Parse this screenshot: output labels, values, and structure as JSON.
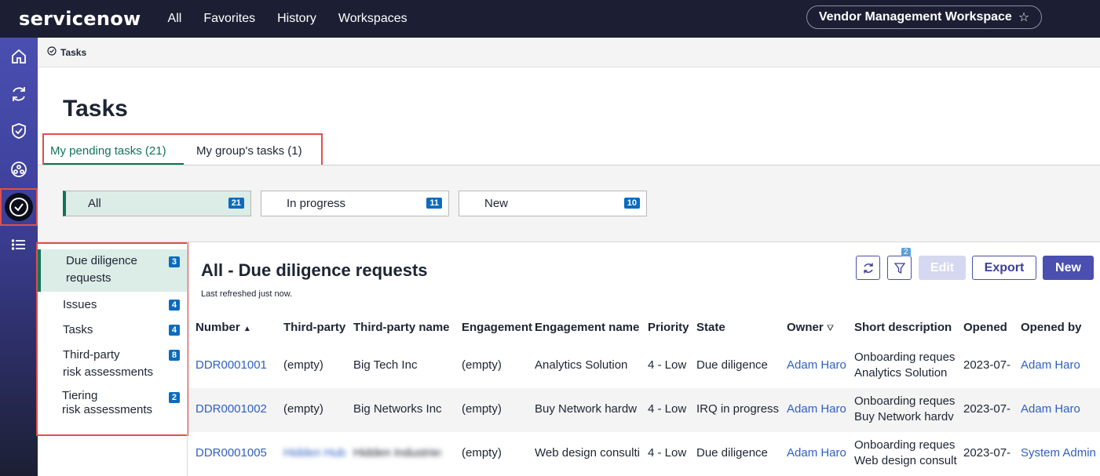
{
  "topbar": {
    "logo": "servicenow",
    "nav": [
      "All",
      "Favorites",
      "History",
      "Workspaces"
    ],
    "workspace": "Vendor Management Workspace"
  },
  "rail": {
    "icons": [
      "home-icon",
      "refresh-icon",
      "shield-check-icon",
      "network-icon",
      "check-circle-icon",
      "list-icon"
    ]
  },
  "breadcrumb": "Tasks",
  "page_title": "Tasks",
  "tabs": [
    {
      "label": "My pending tasks (21)"
    },
    {
      "label": "My group's tasks (1)"
    }
  ],
  "chips": [
    {
      "label": "All",
      "count": "21"
    },
    {
      "label": "In progress",
      "count": "11"
    },
    {
      "label": "New",
      "count": "10"
    }
  ],
  "categories": [
    {
      "line1": "Due diligence",
      "line2": "requests",
      "count": "3"
    },
    {
      "line1": "Issues",
      "line2": "",
      "count": "4"
    },
    {
      "line1": "Tasks",
      "line2": "",
      "count": "4"
    },
    {
      "line1": "Third-party",
      "line2": "risk assessments",
      "count": "8"
    },
    {
      "line1": "Tiering",
      "line2": "risk assessments",
      "count": "2"
    }
  ],
  "list": {
    "title": "All - Due diligence requests",
    "refreshed": "Last refreshed just now.",
    "filter_count": "2",
    "edit_label": "Edit",
    "export_label": "Export",
    "new_label": "New"
  },
  "columns": [
    "Number",
    "Third-party",
    "Third-party name",
    "Engagement",
    "Engagement name",
    "Priority",
    "State",
    "Owner",
    "Short description",
    "Opened",
    "Opened by"
  ],
  "rows": [
    {
      "number": "DDR0001001",
      "third_party": "(empty)",
      "third_party_name": "Big Tech Inc",
      "engagement": "(empty)",
      "engagement_name": "Analytics Solution",
      "priority": "4 - Low",
      "state": "Due diligence",
      "owner": "Adam Haro",
      "desc1": "Onboarding reques",
      "desc2": "Analytics Solution",
      "opened": "2023-07-",
      "opened_by": "Adam Haro"
    },
    {
      "number": "DDR0001002",
      "third_party": "(empty)",
      "third_party_name": "Big Networks Inc",
      "engagement": "(empty)",
      "engagement_name": "Buy Network hardw",
      "priority": "4 - Low",
      "state": "IRQ in progress",
      "owner": "Adam Haro",
      "desc1": "Onboarding reques",
      "desc2": "Buy Network hardv",
      "opened": "2023-07-",
      "opened_by": "Adam Haro"
    },
    {
      "number": "DDR0001005",
      "third_party": "Hidden Hub",
      "third_party_name": "Hidden Industries",
      "engagement": "(empty)",
      "engagement_name": "Web design consulti",
      "priority": "4 - Low",
      "state": "Due diligence",
      "owner": "Adam Haro",
      "desc1": "Onboarding reques",
      "desc2": "Web design consult",
      "opened": "2023-07-",
      "opened_by": "System Admin"
    }
  ]
}
